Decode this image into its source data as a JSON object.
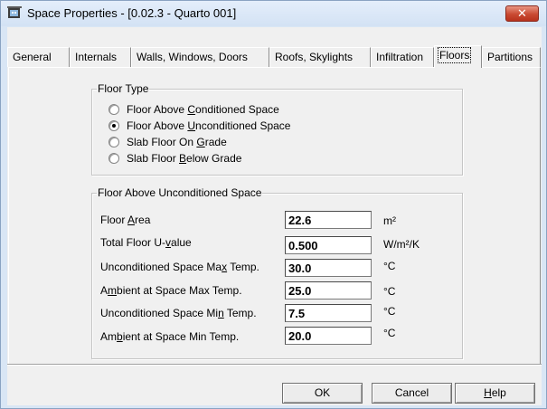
{
  "window": {
    "title": "Space Properties - [0.02.3 - Quarto 001]",
    "close_glyph": "✕"
  },
  "tabs": [
    {
      "label": "General",
      "active": false
    },
    {
      "label": "Internals",
      "active": false
    },
    {
      "label": "Walls, Windows, Doors",
      "active": false
    },
    {
      "label": "Roofs, Skylights",
      "active": false
    },
    {
      "label": "Infiltration",
      "active": false
    },
    {
      "label": "Floors",
      "active": true
    },
    {
      "label": "Partitions",
      "active": false
    }
  ],
  "floor_type": {
    "title": "Floor Type",
    "options": [
      {
        "pre": "Floor Above ",
        "key": "C",
        "post": "onditioned Space",
        "checked": false
      },
      {
        "pre": "Floor Above ",
        "key": "U",
        "post": "nconditioned Space",
        "checked": true
      },
      {
        "pre": "Slab Floor On ",
        "key": "G",
        "post": "rade",
        "checked": false
      },
      {
        "pre": "Slab Floor ",
        "key": "B",
        "post": "elow Grade",
        "checked": false
      }
    ]
  },
  "floor_details": {
    "title": "Floor Above Unconditioned Space",
    "fields": [
      {
        "pre": "Floor ",
        "key": "A",
        "post": "rea",
        "value": "22.6",
        "unit": "m²"
      },
      {
        "pre": "Total Floor U-",
        "key": "v",
        "post": "alue",
        "value": "0.500",
        "unit": "W/m²/K"
      },
      {
        "pre": "Unconditioned Space Ma",
        "key": "x",
        "post": " Temp.",
        "value": "30.0",
        "unit": "°C"
      },
      {
        "pre": "A",
        "key": "m",
        "post": "bient at Space Max Temp.",
        "value": "25.0",
        "unit": "°C"
      },
      {
        "pre": "Unconditioned Space Mi",
        "key": "n",
        "post": " Temp.",
        "value": "7.5",
        "unit": "°C"
      },
      {
        "pre": "Am",
        "key": "b",
        "post": "ient at Space Min Temp.",
        "value": "20.0",
        "unit": "°C"
      }
    ]
  },
  "buttons": {
    "ok": "OK",
    "cancel": "Cancel",
    "help_key": "H",
    "help_rest": "elp"
  }
}
